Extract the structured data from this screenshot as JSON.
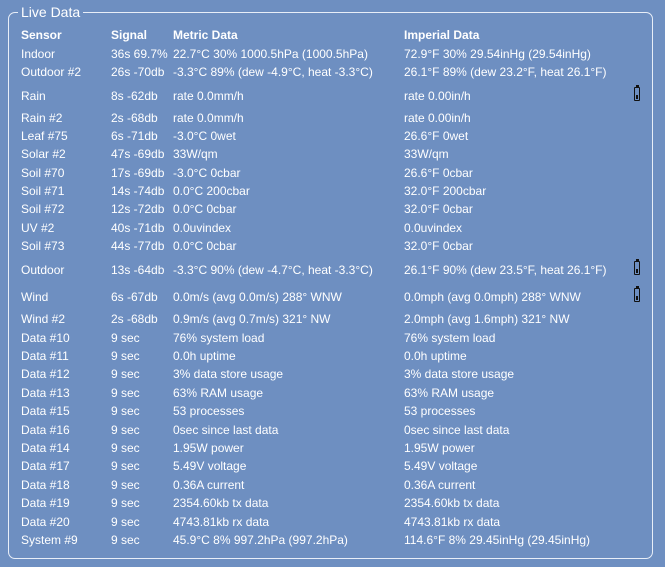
{
  "panel": {
    "title": "Live Data"
  },
  "headers": {
    "sensor": "Sensor",
    "signal": "Signal",
    "metric": "Metric Data",
    "imperial": "Imperial Data"
  },
  "rows": [
    {
      "sensor": "Indoor",
      "signal": "36s 69.7%",
      "metric": "22.7°C 30% 1000.5hPa (1000.5hPa)",
      "imperial": "72.9°F 30% 29.54inHg (29.54inHg)",
      "battery_icon": ""
    },
    {
      "sensor": "Outdoor #2",
      "signal": "26s -70db",
      "metric": "-3.3°C 89% (dew -4.9°C, heat -3.3°C)",
      "imperial": "26.1°F 89% (dew 23.2°F, heat 26.1°F)",
      "battery_icon": ""
    },
    {
      "sensor": "Rain",
      "signal": "8s -62db",
      "metric": "rate 0.0mm/h",
      "imperial": "rate 0.00in/h",
      "battery_icon": "low-battery-icon"
    },
    {
      "sensor": "Rain #2",
      "signal": "2s -68db",
      "metric": "rate 0.0mm/h",
      "imperial": "rate 0.00in/h",
      "battery_icon": ""
    },
    {
      "sensor": "Leaf #75",
      "signal": "6s -71db",
      "metric": "-3.0°C 0wet",
      "imperial": "26.6°F 0wet",
      "battery_icon": ""
    },
    {
      "sensor": "Solar #2",
      "signal": "47s -69db",
      "metric": "33W/qm",
      "imperial": "33W/qm",
      "battery_icon": ""
    },
    {
      "sensor": "Soil #70",
      "signal": "17s -69db",
      "metric": "-3.0°C 0cbar",
      "imperial": "26.6°F 0cbar",
      "battery_icon": ""
    },
    {
      "sensor": "Soil #71",
      "signal": "14s -74db",
      "metric": "0.0°C 200cbar",
      "imperial": "32.0°F 200cbar",
      "battery_icon": ""
    },
    {
      "sensor": "Soil #72",
      "signal": "12s -72db",
      "metric": "0.0°C 0cbar",
      "imperial": "32.0°F 0cbar",
      "battery_icon": ""
    },
    {
      "sensor": "UV #2",
      "signal": "40s -71db",
      "metric": "0.0uvindex",
      "imperial": "0.0uvindex",
      "battery_icon": ""
    },
    {
      "sensor": "Soil #73",
      "signal": "44s -77db",
      "metric": "0.0°C 0cbar",
      "imperial": "32.0°F 0cbar",
      "battery_icon": ""
    },
    {
      "sensor": "Outdoor",
      "signal": "13s -64db",
      "metric": "-3.3°C 90% (dew -4.7°C, heat -3.3°C)",
      "imperial": "26.1°F 90% (dew 23.5°F, heat 26.1°F)",
      "battery_icon": "low-battery-icon"
    },
    {
      "sensor": "Wind",
      "signal": "6s -67db",
      "metric": "0.0m/s (avg 0.0m/s) 288° WNW",
      "imperial": "0.0mph (avg 0.0mph) 288° WNW",
      "battery_icon": "low-battery-icon"
    },
    {
      "sensor": "Wind #2",
      "signal": "2s -68db",
      "metric": "0.9m/s (avg 0.7m/s) 321° NW",
      "imperial": "2.0mph (avg 1.6mph) 321° NW",
      "battery_icon": ""
    },
    {
      "sensor": "Data #10",
      "signal": "9 sec",
      "metric": "76% system load",
      "imperial": "76% system load",
      "battery_icon": ""
    },
    {
      "sensor": "Data #11",
      "signal": "9 sec",
      "metric": "0.0h uptime",
      "imperial": "0.0h uptime",
      "battery_icon": ""
    },
    {
      "sensor": "Data #12",
      "signal": "9 sec",
      "metric": "3% data store usage",
      "imperial": "3% data store usage",
      "battery_icon": ""
    },
    {
      "sensor": "Data #13",
      "signal": "9 sec",
      "metric": "63% RAM usage",
      "imperial": "63% RAM usage",
      "battery_icon": ""
    },
    {
      "sensor": "Data #15",
      "signal": "9 sec",
      "metric": "53 processes",
      "imperial": "53 processes",
      "battery_icon": ""
    },
    {
      "sensor": "Data #16",
      "signal": "9 sec",
      "metric": "0sec since last data",
      "imperial": "0sec since last data",
      "battery_icon": ""
    },
    {
      "sensor": "Data #14",
      "signal": "9 sec",
      "metric": "1.95W power",
      "imperial": "1.95W power",
      "battery_icon": ""
    },
    {
      "sensor": "Data #17",
      "signal": "9 sec",
      "metric": "5.49V voltage",
      "imperial": "5.49V voltage",
      "battery_icon": ""
    },
    {
      "sensor": "Data #18",
      "signal": "9 sec",
      "metric": "0.36A current",
      "imperial": "0.36A current",
      "battery_icon": ""
    },
    {
      "sensor": "Data #19",
      "signal": "9 sec",
      "metric": "2354.60kb tx data",
      "imperial": "2354.60kb tx data",
      "battery_icon": ""
    },
    {
      "sensor": "Data #20",
      "signal": "9 sec",
      "metric": "4743.81kb rx data",
      "imperial": "4743.81kb rx data",
      "battery_icon": ""
    },
    {
      "sensor": "System #9",
      "signal": "9 sec",
      "metric": "45.9°C 8% 997.2hPa (997.2hPa)",
      "imperial": "114.6°F 8% 29.45inHg (29.45inHg)",
      "battery_icon": ""
    }
  ]
}
